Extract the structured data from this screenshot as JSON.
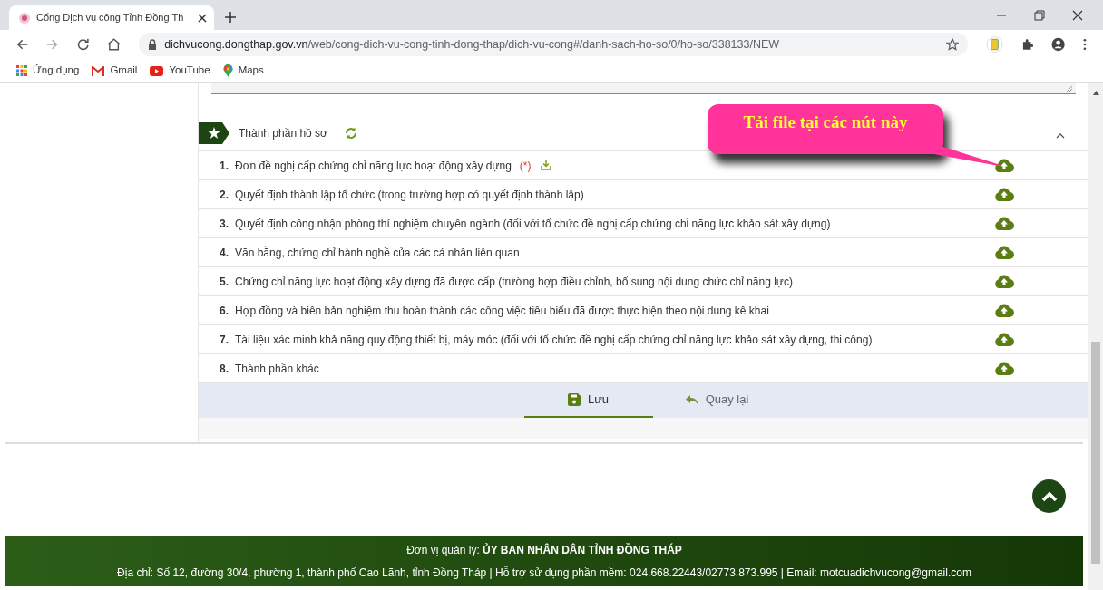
{
  "browser": {
    "tab_title": "Cổng Dịch vụ công Tỉnh Đồng Th",
    "url_host": "dichvucong.dongthap.gov.vn",
    "url_path": "/web/cong-dich-vu-cong-tinh-dong-thap/dich-vu-cong#/danh-sach-ho-so/0/ho-so/338133/NEW",
    "bookmarks": [
      {
        "kind": "apps",
        "label": "Ứng dụng"
      },
      {
        "kind": "gmail",
        "label": "Gmail"
      },
      {
        "kind": "youtube",
        "label": "YouTube"
      },
      {
        "kind": "maps",
        "label": "Maps"
      }
    ]
  },
  "section": {
    "title": "Thành phần hồ sơ",
    "expanded": true
  },
  "callout": "Tải file tại các nút này",
  "documents": [
    {
      "number": "1.",
      "label": "Đơn đề nghị cấp chứng chỉ năng lực hoạt động xây dựng",
      "required": "(*)",
      "template": true
    },
    {
      "number": "2.",
      "label": "Quyết định thành lập tổ chức (trong trường hợp có quyết định thành lập)",
      "template": false
    },
    {
      "number": "3.",
      "label": "Quyết định công nhận phòng thí nghiệm chuyên ngành (đối với tổ chức đề nghị cấp chứng chỉ năng lực khảo sát xây dựng)",
      "template": false
    },
    {
      "number": "4.",
      "label": "Văn bằng, chứng chỉ hành nghề của các cá nhân liên quan",
      "template": false
    },
    {
      "number": "5.",
      "label": "Chứng chỉ năng lực hoạt động xây dựng đã được cấp (trường hợp điều chỉnh, bổ sung nội dung chức chỉ năng lực)",
      "template": false
    },
    {
      "number": "6.",
      "label": "Hợp đồng và biên bản nghiệm thu hoàn thành các công việc tiêu biểu đã được thực hiện theo nội dung kê khai",
      "template": false
    },
    {
      "number": "7.",
      "label": "Tài liệu xác minh khả năng quy động thiết bị, máy móc (đối với tổ chức đề nghị cấp chứng chỉ năng lực khảo sát xây dựng, thi công)",
      "template": false
    },
    {
      "number": "8.",
      "label": "Thành phần khác",
      "template": false
    }
  ],
  "actions": [
    {
      "kind": "save",
      "label": "Lưu",
      "selected": true
    },
    {
      "kind": "back",
      "label": "Quay lại",
      "selected": false
    }
  ],
  "footer": {
    "agency": "Đơn vị quản lý: **ỦY BAN NHÂN DÂN TỈNH ĐỒNG THÁP**",
    "contact": "Địa chỉ: Số 12, đường 30/4, phường 1, thành phố Cao Lãnh, tỉnh Đồng Tháp | Hỗ trợ sử dụng phần mềm: 024.668.22443/02773.873.995 | Email: motcuadichvucong@gmail.com"
  }
}
